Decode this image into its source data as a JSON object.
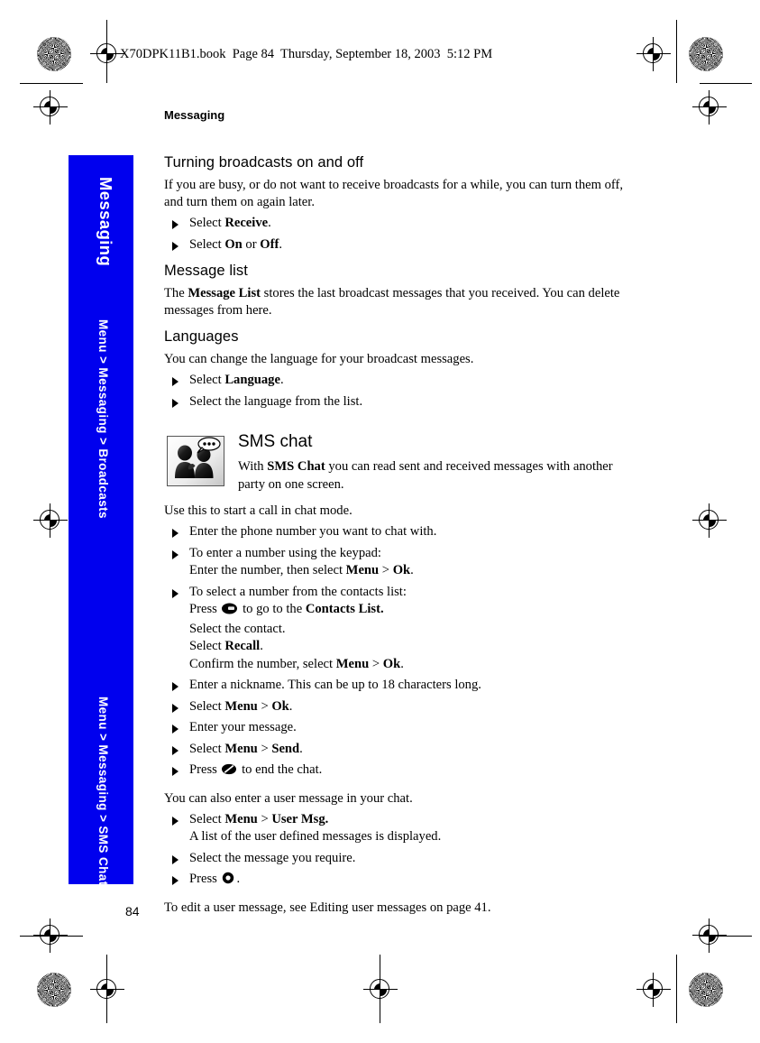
{
  "header": {
    "file_line": "X70DPK11B1.book  Page 84  Thursday, September 18, 2003  5:12 PM"
  },
  "side_tab": {
    "chapter": "Messaging",
    "path_top": "Menu > Messaging > Broadcasts",
    "path_bottom": "Menu > Messaging > SMS Chat",
    "color": "#0000ee",
    "text_color": "#ffffff"
  },
  "running_head": "Messaging",
  "sections": {
    "broadcasts": {
      "heading": "Turning broadcasts on and off",
      "intro": "If you are busy, or do not want to receive broadcasts for a while, you can turn them off, and turn them on again later.",
      "steps": [
        {
          "prefix": "Select ",
          "bold1": "Receive",
          "mid": "",
          "bold2": "",
          "suffix": "."
        },
        {
          "prefix": "Select ",
          "bold1": "On",
          "mid": " or ",
          "bold2": "Off",
          "suffix": "."
        }
      ]
    },
    "message_list": {
      "heading": "Message list",
      "para_pre": "The ",
      "para_bold": "Message List",
      "para_post": " stores the last broadcast messages that you received. You can delete messages from here."
    },
    "languages": {
      "heading": "Languages",
      "intro": "You can change the language for your broadcast messages.",
      "steps": [
        {
          "prefix": "Select ",
          "bold1": "Language",
          "suffix": "."
        },
        {
          "prefix": "Select the language from the list.",
          "bold1": "",
          "suffix": ""
        }
      ]
    },
    "sms_chat": {
      "heading": "SMS chat",
      "icon_name": "sms-chat-icon",
      "intro_pre": "With ",
      "intro_bold": "SMS Chat",
      "intro_post": " you can read sent and received messages with another party on one screen.",
      "use_line": "Use this to start a call in chat mode.",
      "step1": "Enter the phone number you want to chat with.",
      "step2_line1": "To enter a number using the keypad:",
      "step2_line2_pre": "Enter the number, then select ",
      "step2_menu": "Menu",
      "step2_sep": " > ",
      "step2_ok": "Ok",
      "step2_end": ".",
      "step3_line1": " To select a number from the contacts list:",
      "step3_line2_pre": "Press ",
      "step3_line2_mid": " to go to the ",
      "step3_line2_bold": "Contacts List.",
      "step3_line3": "Select the contact.",
      "step3_line4_pre": "Select ",
      "step3_line4_bold": "Recall",
      "step3_line4_end": ".",
      "step3_line5_pre": "Confirm the number, select ",
      "step3_line5_menu": "Menu",
      "step3_line5_sep": " > ",
      "step3_line5_ok": "Ok",
      "step3_line5_end": ".",
      "step4": "Enter a nickname. This can be up to 18 characters long.",
      "step5_pre": "Select ",
      "step5_menu": "Menu",
      "step5_sep": " > ",
      "step5_ok": "Ok",
      "step5_end": ".",
      "step6": "Enter your message.",
      "step7_pre": "Select ",
      "step7_menu": "Menu",
      "step7_sep": " > ",
      "step7_send": "Send",
      "step7_end": ".",
      "step8_pre": "Press ",
      "step8_post": " to end the chat.",
      "user_msg_line": "You can also enter a user message in your chat.",
      "step9_pre": "Select ",
      "step9_menu": "Menu",
      "step9_sep": " > ",
      "step9_bold": "User Msg.",
      "step9_sub": "A list of the user defined messages is displayed.",
      "step10": "Select the message you require.",
      "step11_pre": "Press ",
      "step11_post": ".",
      "closing": "To edit a user message, see Editing user messages on page 41."
    }
  },
  "page_number": "84"
}
